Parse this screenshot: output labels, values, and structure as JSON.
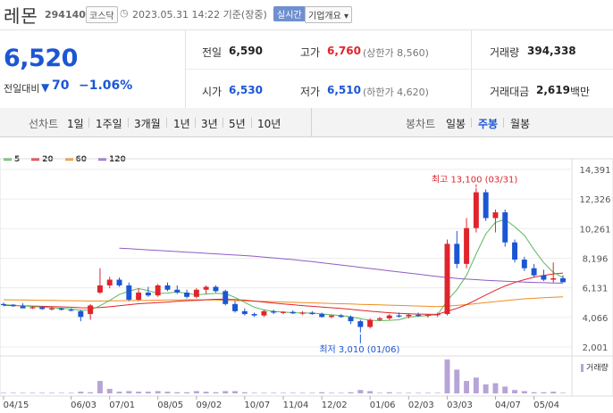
{
  "header": {
    "name": "레몬",
    "code": "294140",
    "market": "코스닥",
    "timestamp": "2023.05.31 14:22 기준(장중)",
    "realtime_label": "실시간",
    "info_label": "기업개요 ▾"
  },
  "summary": {
    "price": "6,520",
    "compare_label": "전일대비",
    "change": "70",
    "change_rate": "−1.06%",
    "prev_label": "전일",
    "prev_value": "6,590",
    "high_label": "고가",
    "high_value": "6,760",
    "upper_limit": "(상한가 8,560)",
    "volume_label": "거래량",
    "volume_value": "394,338",
    "open_label": "시가",
    "open_value": "6,530",
    "low_label": "저가",
    "low_value": "6,510",
    "lower_limit": "(하한가 4,620)",
    "amount_label": "거래대금",
    "amount_value": "2,619",
    "amount_unit": "백만"
  },
  "tabs": {
    "line_label": "선차트",
    "line_periods": [
      "1일",
      "1주일",
      "3개월",
      "1년",
      "3년",
      "5년",
      "10년"
    ],
    "candle_label": "봉차트",
    "candle_periods": [
      "일봉",
      "주봉",
      "월봉"
    ],
    "active_candle": "주봉"
  },
  "colors": {
    "up": "#e0242c",
    "down": "#1b56d4",
    "ma5": "#5cb85c",
    "ma20": "#e0242c",
    "ma60": "#f08c1e",
    "ma120": "#8e5bc6",
    "volume": "#b7a4d6"
  },
  "chart_data": {
    "type": "candlestick",
    "interval": "weekly",
    "legend": [
      {
        "name": "5",
        "color": "#5cb85c"
      },
      {
        "name": "20",
        "color": "#e0242c"
      },
      {
        "name": "60",
        "color": "#f08c1e"
      },
      {
        "name": "120",
        "color": "#8e5bc6"
      }
    ],
    "y_ticks": [
      14391,
      12326,
      10261,
      8196,
      6131,
      4066,
      2001
    ],
    "y_tick_labels": [
      "14,391",
      "12,326",
      "10,261",
      "8,196",
      "6,131",
      "4,066",
      "2,001"
    ],
    "ylim": [
      2001,
      14391
    ],
    "x_labels": [
      "04/15",
      "06/03",
      "07/01",
      "08/05",
      "09/02",
      "10/07",
      "11/04",
      "12/02",
      "01/06",
      "02/03",
      "03/03",
      "04/07",
      "05/04"
    ],
    "x_label_weeks": [
      0,
      7,
      11,
      16,
      20,
      25,
      29,
      33,
      38,
      42,
      46,
      51,
      55
    ],
    "high_annotation": "최고 13,100 (03/31)",
    "low_annotation": "최저 3,010 (01/06)",
    "volume_badge": "거래량",
    "candles": [
      [
        5000,
        5100,
        4850,
        4950
      ],
      [
        4950,
        5000,
        4800,
        4850
      ],
      [
        4850,
        5050,
        4750,
        4700
      ],
      [
        4700,
        4850,
        4650,
        4780
      ],
      [
        4780,
        4850,
        4600,
        4650
      ],
      [
        4650,
        4800,
        4550,
        4700
      ],
      [
        4700,
        4750,
        4550,
        4600
      ],
      [
        4600,
        4700,
        4500,
        4550
      ],
      [
        4500,
        4600,
        3800,
        4100
      ],
      [
        4300,
        5000,
        3900,
        4900
      ],
      [
        5800,
        7500,
        5700,
        6300
      ],
      [
        6300,
        6900,
        6100,
        6700
      ],
      [
        6700,
        6850,
        6200,
        6300
      ],
      [
        6300,
        6500,
        5200,
        5300
      ],
      [
        5300,
        6100,
        5200,
        5800
      ],
      [
        5800,
        6200,
        5500,
        5600
      ],
      [
        5600,
        6400,
        5500,
        6300
      ],
      [
        6300,
        6500,
        5900,
        6000
      ],
      [
        6000,
        6300,
        5700,
        5800
      ],
      [
        5800,
        6000,
        5400,
        5500
      ],
      [
        5500,
        6100,
        5400,
        6000
      ],
      [
        6000,
        6300,
        5700,
        6200
      ],
      [
        6200,
        6300,
        5800,
        5900
      ],
      [
        5900,
        6000,
        4900,
        5000
      ],
      [
        5000,
        5200,
        4400,
        4500
      ],
      [
        4500,
        4700,
        4200,
        4300
      ],
      [
        4300,
        4400,
        4100,
        4200
      ],
      [
        4200,
        4600,
        4100,
        4500
      ],
      [
        4500,
        4600,
        4300,
        4400
      ],
      [
        4400,
        4500,
        4300,
        4450
      ],
      [
        4450,
        4550,
        4300,
        4350
      ],
      [
        4350,
        4500,
        4250,
        4400
      ],
      [
        4400,
        4500,
        4250,
        4300
      ],
      [
        4300,
        4400,
        4050,
        4100
      ],
      [
        4100,
        4250,
        4000,
        4200
      ],
      [
        4200,
        4300,
        4050,
        4100
      ],
      [
        4100,
        4200,
        3600,
        3800
      ],
      [
        3800,
        3900,
        3010,
        3400
      ],
      [
        3400,
        4000,
        3300,
        3900
      ],
      [
        3900,
        4100,
        3800,
        4000
      ],
      [
        4000,
        4300,
        3900,
        4200
      ],
      [
        4200,
        4400,
        4050,
        4150
      ],
      [
        4150,
        4300,
        4000,
        4250
      ],
      [
        4250,
        4400,
        4100,
        4200
      ],
      [
        4200,
        4300,
        4050,
        4250
      ],
      [
        4250,
        4400,
        4100,
        4300
      ],
      [
        4300,
        9500,
        4200,
        9200
      ],
      [
        9200,
        10100,
        7500,
        7800
      ],
      [
        7800,
        11000,
        7500,
        10300
      ],
      [
        10300,
        13100,
        10000,
        12800
      ],
      [
        12800,
        13000,
        10800,
        11000
      ],
      [
        11000,
        11600,
        10000,
        11400
      ],
      [
        11400,
        11600,
        9000,
        9300
      ],
      [
        9300,
        9500,
        7900,
        8100
      ],
      [
        8100,
        8300,
        7300,
        7500
      ],
      [
        7500,
        7800,
        6900,
        7000
      ],
      [
        7000,
        7400,
        6600,
        6700
      ],
      [
        6700,
        7900,
        6500,
        6800
      ],
      [
        6800,
        7000,
        6500,
        6520
      ]
    ],
    "ma5": [
      4950,
      4920,
      4870,
      4830,
      4780,
      4740,
      4700,
      4660,
      4560,
      4580,
      4880,
      5250,
      5660,
      5900,
      6080,
      5940,
      5740,
      5760,
      5840,
      5740,
      5640,
      5700,
      5740,
      5720,
      5470,
      5120,
      4780,
      4600,
      4480,
      4440,
      4390,
      4380,
      4370,
      4310,
      4250,
      4200,
      4110,
      3980,
      3860,
      3840,
      3860,
      3900,
      4090,
      4150,
      4200,
      4250,
      5240,
      6000,
      7000,
      8500,
      9900,
      10700,
      10900,
      10400,
      9800,
      8800,
      7900,
      7200,
      6850
    ],
    "ma20": [
      4900,
      4890,
      4880,
      4860,
      4840,
      4820,
      4800,
      4780,
      4740,
      4720,
      4750,
      4810,
      4880,
      4950,
      5020,
      5060,
      5100,
      5140,
      5190,
      5230,
      5260,
      5300,
      5330,
      5340,
      5320,
      5270,
      5210,
      5140,
      5070,
      5010,
      4950,
      4890,
      4840,
      4790,
      4740,
      4690,
      4630,
      4560,
      4500,
      4440,
      4390,
      4350,
      4320,
      4300,
      4290,
      4280,
      4500,
      4700,
      4960,
      5290,
      5630,
      5960,
      6260,
      6500,
      6700,
      6870,
      7000,
      7100,
      7160
    ],
    "ma60": [
      5300,
      5290,
      5280,
      5270,
      5260,
      5250,
      5240,
      5230,
      5220,
      5210,
      5210,
      5220,
      5230,
      5240,
      5250,
      5260,
      5270,
      5280,
      5290,
      5300,
      5300,
      5290,
      5280,
      5260,
      5240,
      5220,
      5200,
      5180,
      5160,
      5140,
      5120,
      5100,
      5080,
      5060,
      5040,
      5020,
      5000,
      4980,
      4960,
      4940,
      4920,
      4900,
      4880,
      4860,
      4840,
      4820,
      4860,
      4900,
      4960,
      5030,
      5100,
      5170,
      5240,
      5300,
      5360,
      5400,
      5440,
      5470,
      5500
    ],
    "ma120": [
      9300,
      9280,
      9250,
      9220,
      9190,
      9160,
      9130,
      9100,
      9060,
      9020,
      8980,
      8940,
      8900,
      8860,
      8820,
      8780,
      8740,
      8700,
      8660,
      8620,
      8580,
      8540,
      8500,
      8460,
      8420,
      8380,
      8330,
      8280,
      8220,
      8160,
      8100,
      8030,
      7960,
      7880,
      7800,
      7720,
      7640,
      7560,
      7480,
      7400,
      7320,
      7240,
      7160,
      7080,
      7000,
      6920,
      6850,
      6790,
      6740,
      6700,
      6660,
      6620,
      6590,
      6560,
      6530,
      6510,
      6490,
      6470,
      6460
    ],
    "volume": [
      1,
      1,
      1,
      1,
      1,
      1,
      1,
      1,
      3,
      2,
      22,
      8,
      3,
      4,
      3,
      3,
      4,
      3,
      2,
      2,
      4,
      3,
      2,
      4,
      4,
      2,
      1,
      1,
      1,
      1,
      1,
      1,
      1,
      2,
      1,
      1,
      2,
      6,
      4,
      1,
      2,
      1,
      1,
      1,
      1,
      1,
      60,
      42,
      22,
      28,
      16,
      18,
      12,
      6,
      4,
      2,
      2,
      3,
      1
    ]
  }
}
